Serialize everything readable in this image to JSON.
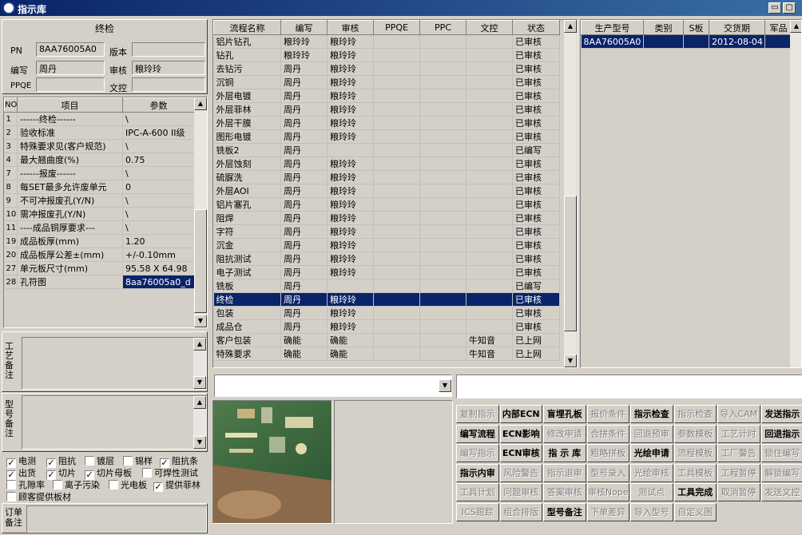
{
  "window": {
    "title": "指示库"
  },
  "left": {
    "header": "终检",
    "pn_label": "PN",
    "pn_value": "8AA76005A0",
    "version_label": "版本",
    "version_value": "",
    "author_label": "编写",
    "author_value": "周丹",
    "review_label": "审核",
    "review_value": "粮玲玲",
    "ppqe_label": "PPQE",
    "ppqe_value": "",
    "doccontrol_label": "文控",
    "doccontrol_value": "",
    "param_headers": [
      "NO",
      "项目",
      "参数"
    ],
    "params": [
      {
        "no": "1",
        "item": "------终检------",
        "value": "\\"
      },
      {
        "no": "2",
        "item": "验收标准",
        "value": "IPC-A-600 II级"
      },
      {
        "no": "3",
        "item": "特殊要求见(客户规范)",
        "value": "\\"
      },
      {
        "no": "4",
        "item": "最大翘曲度(%)",
        "value": "0.75"
      },
      {
        "no": "7",
        "item": "------报废------",
        "value": "\\"
      },
      {
        "no": "8",
        "item": "每SET最多允许废单元",
        "value": "0"
      },
      {
        "no": "9",
        "item": "不可冲报废孔(Y/N)",
        "value": "\\"
      },
      {
        "no": "10",
        "item": "需冲报废孔(Y/N)",
        "value": "\\"
      },
      {
        "no": "11",
        "item": "----成品铜厚要求---",
        "value": "\\"
      },
      {
        "no": "19",
        "item": "成品板厚(mm)",
        "value": "1.20"
      },
      {
        "no": "20",
        "item": "成品板厚公差±(mm)",
        "value": "+/-0.10mm"
      },
      {
        "no": "27",
        "item": "单元板尺寸(mm)",
        "value": "95.58 X 64.98"
      },
      {
        "no": "28",
        "item": "孔符图",
        "value": "8aa76005a0_d"
      }
    ],
    "process_note_label": "工艺备注",
    "model_note_label": "型号备注",
    "order_note_label": "订单备注",
    "checks": [
      {
        "label": "电测",
        "checked": true
      },
      {
        "label": "阻抗",
        "checked": true
      },
      {
        "label": "镀层",
        "checked": false
      },
      {
        "label": "锡样",
        "checked": false
      },
      {
        "label": "阻抗条",
        "checked": true
      },
      {
        "label": "出货",
        "checked": true
      },
      {
        "label": "切片",
        "checked": true
      },
      {
        "label": "切片母板",
        "checked": true
      },
      {
        "label": "可焊性测试",
        "checked": false
      },
      {
        "label": "孔隙率",
        "checked": false
      },
      {
        "label": "离子污染",
        "checked": false
      },
      {
        "label": "光电板",
        "checked": false
      },
      {
        "label": "提供菲林",
        "checked": true
      },
      {
        "label": "顾客提供板材",
        "checked": false
      }
    ]
  },
  "process": {
    "headers": [
      "流程名称",
      "编写",
      "审核",
      "PPQE",
      "PPC",
      "文控",
      "状态"
    ],
    "rows": [
      [
        "铝片钻孔",
        "粮玲玲",
        "粮玲玲",
        "",
        "",
        "",
        "已审核"
      ],
      [
        "钻孔",
        "粮玲玲",
        "粮玲玲",
        "",
        "",
        "",
        "已审核"
      ],
      [
        "去钻污",
        "周丹",
        "粮玲玲",
        "",
        "",
        "",
        "已审核"
      ],
      [
        "沉铜",
        "周丹",
        "粮玲玲",
        "",
        "",
        "",
        "已审核"
      ],
      [
        "外层电镀",
        "周丹",
        "粮玲玲",
        "",
        "",
        "",
        "已审核"
      ],
      [
        "外层菲林",
        "周丹",
        "粮玲玲",
        "",
        "",
        "",
        "已审核"
      ],
      [
        "外层干膜",
        "周丹",
        "粮玲玲",
        "",
        "",
        "",
        "已审核"
      ],
      [
        "图形电镀",
        "周丹",
        "粮玲玲",
        "",
        "",
        "",
        "已审核"
      ],
      [
        "铣板2",
        "周丹",
        "",
        "",
        "",
        "",
        "已编写"
      ],
      [
        "外层蚀刻",
        "周丹",
        "粮玲玲",
        "",
        "",
        "",
        "已审核"
      ],
      [
        "硫脲洗",
        "周丹",
        "粮玲玲",
        "",
        "",
        "",
        "已审核"
      ],
      [
        "外层AOI",
        "周丹",
        "粮玲玲",
        "",
        "",
        "",
        "已审核"
      ],
      [
        "铝片塞孔",
        "周丹",
        "粮玲玲",
        "",
        "",
        "",
        "已审核"
      ],
      [
        "阻焊",
        "周丹",
        "粮玲玲",
        "",
        "",
        "",
        "已审核"
      ],
      [
        "字符",
        "周丹",
        "粮玲玲",
        "",
        "",
        "",
        "已审核"
      ],
      [
        "沉金",
        "周丹",
        "粮玲玲",
        "",
        "",
        "",
        "已审核"
      ],
      [
        "阻抗测试",
        "周丹",
        "粮玲玲",
        "",
        "",
        "",
        "已审核"
      ],
      [
        "电子测试",
        "周丹",
        "粮玲玲",
        "",
        "",
        "",
        "已审核"
      ],
      [
        "铣板",
        "周丹",
        "",
        "",
        "",
        "",
        "已编写"
      ],
      [
        "终检",
        "周丹",
        "粮玲玲",
        "",
        "",
        "",
        "已审核"
      ],
      [
        "包装",
        "周丹",
        "粮玲玲",
        "",
        "",
        "",
        "已审核"
      ],
      [
        "成品仓",
        "周丹",
        "粮玲玲",
        "",
        "",
        "",
        "已审核"
      ],
      [
        "客户包装",
        "确能",
        "确能",
        "",
        "",
        "牛知音",
        "已上网"
      ],
      [
        "特殊要求",
        "确能",
        "确能",
        "",
        "",
        "牛知音",
        "已上网"
      ]
    ],
    "selected_index": 19
  },
  "models": {
    "headers": [
      "生产型号",
      "类别",
      "S板",
      "交货期",
      "军品"
    ],
    "rows": [
      [
        "8AA76005A0",
        "",
        "",
        "2012-08-04",
        ""
      ]
    ]
  },
  "buttons": [
    [
      "复制指示",
      "内部ECN",
      "盲埋孔板",
      "报价条件",
      "指示检查",
      "指示检查",
      "导入CAM",
      "发送指示"
    ],
    [
      "编写流程",
      "ECN影响",
      "修改申请",
      "合拼条件",
      "回退预审",
      "参数模板",
      "工艺计时",
      "回退指示"
    ],
    [
      "编写指示",
      "ECN审核",
      "指 示 库",
      "粗略拼板",
      "光绘申请",
      "流程模板",
      "工厂警告",
      "锁住编写"
    ],
    [
      "指示内审",
      "风险警告",
      "指示退审",
      "型号录入",
      "光绘审核",
      "工具模板",
      "工程暂停",
      "解锁编写"
    ],
    [
      "工具计划",
      "问题审核",
      "答案审核",
      "审核Nope",
      "测试点",
      "工具完成",
      "取消暂停",
      "发送文控"
    ],
    [
      "ICS跟踪",
      "组合排版",
      "型号备注",
      "下单差异",
      "导入型号",
      "自定义图",
      "",
      ""
    ]
  ],
  "button_enabled": [
    [
      false,
      true,
      true,
      false,
      true,
      false,
      false,
      true
    ],
    [
      true,
      true,
      false,
      false,
      false,
      false,
      false,
      true
    ],
    [
      false,
      true,
      true,
      false,
      true,
      false,
      false,
      false
    ],
    [
      true,
      false,
      false,
      false,
      false,
      false,
      false,
      false
    ],
    [
      false,
      false,
      false,
      false,
      false,
      true,
      false,
      false
    ],
    [
      false,
      false,
      true,
      false,
      false,
      false,
      false,
      false
    ]
  ]
}
